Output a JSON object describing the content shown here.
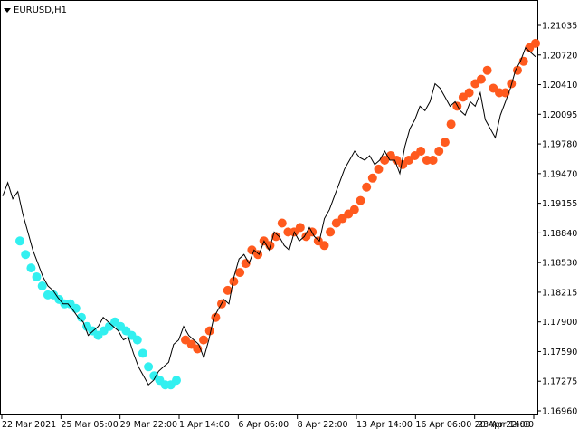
{
  "header": {
    "symbol_label": "EURUSD,H1",
    "dropdown_icon": "triangle-down-icon"
  },
  "colors": {
    "background": "#ffffff",
    "price_line": "#000000",
    "bullish_marker": "#ff5a1e",
    "bearish_marker": "#32f0f0",
    "axis": "#000000"
  },
  "chart_data": {
    "type": "line",
    "title": "",
    "xlabel": "",
    "ylabel": "",
    "x_tick_labels": [
      "22 Mar 2021",
      "25 Mar 05:00",
      "29 Mar 22:00",
      "1 Apr 14:00",
      "6 Apr 06:00",
      "8 Apr 22:00",
      "13 Apr 14:00",
      "16 Apr 06:00",
      "20 Apr 22:00",
      "23 Apr 14:00"
    ],
    "y_tick_labels": [
      "1.21035",
      "1.20720",
      "1.20410",
      "1.20095",
      "1.19780",
      "1.19470",
      "1.19155",
      "1.18840",
      "1.18530",
      "1.18215",
      "1.17900",
      "1.17590",
      "1.17275",
      "1.16960"
    ],
    "ylim": [
      1.1696,
      1.2125
    ],
    "grid": false,
    "series": [
      {
        "values": [
          1.1935,
          1.195,
          1.1932,
          1.194,
          1.1915,
          1.1895,
          1.1875,
          1.186,
          1.1845,
          1.1835,
          1.183,
          1.1822,
          1.1815,
          1.1815,
          1.1808,
          1.18,
          1.1795,
          1.178,
          1.1785,
          1.179,
          1.18,
          1.1795,
          1.179,
          1.1785,
          1.1775,
          1.1778,
          1.176,
          1.1745,
          1.1735,
          1.1725,
          1.173,
          1.174,
          1.1745,
          1.175,
          1.177,
          1.1775,
          1.179,
          1.178,
          1.1775,
          1.177,
          1.1755,
          1.1775,
          1.18,
          1.181,
          1.182,
          1.1815,
          1.1845,
          1.1865,
          1.187,
          1.186,
          1.1875,
          1.187,
          1.1885,
          1.1875,
          1.1895,
          1.189,
          1.188,
          1.1875,
          1.1895,
          1.1885,
          1.189,
          1.19,
          1.189,
          1.1885,
          1.191,
          1.192,
          1.1935,
          1.195,
          1.1965,
          1.1975,
          1.1985,
          1.1978,
          1.1975,
          1.198,
          1.197,
          1.1975,
          1.1985,
          1.1975,
          1.1975,
          1.196,
          1.199,
          1.201,
          1.202,
          1.2035,
          1.203,
          1.204,
          1.206,
          1.2055,
          1.2045,
          1.2035,
          1.204,
          1.203,
          1.2025,
          1.204,
          1.2035,
          1.205,
          1.202,
          1.201,
          1.2,
          1.2025,
          1.204,
          1.2055,
          1.2075,
          1.2085,
          1.21,
          1.2095,
          1.209
        ]
      }
    ],
    "markers": {
      "bullish_values": [
        1.1775,
        1.177,
        1.1765,
        1.1775,
        1.1785,
        1.18,
        1.1815,
        1.183,
        1.184,
        1.185,
        1.186,
        1.1875,
        1.187,
        1.1885,
        1.188,
        1.189,
        1.1905,
        1.1895,
        1.1895,
        1.19,
        1.189,
        1.1895,
        1.1885,
        1.188,
        1.1895,
        1.1905,
        1.191,
        1.1915,
        1.192,
        1.193,
        1.1945,
        1.1955,
        1.1965,
        1.1975,
        1.198,
        1.1975,
        1.197,
        1.1975,
        1.198,
        1.1985,
        1.1975,
        1.1975,
        1.1985,
        1.1995,
        1.2015,
        1.2035,
        1.2045,
        1.205,
        1.206,
        1.2065,
        1.2075,
        1.2055,
        1.205,
        1.205,
        1.206,
        1.2075,
        1.2085,
        1.21,
        1.2105
      ],
      "bearish_values": [
        1.1885,
        1.187,
        1.1855,
        1.1845,
        1.1835,
        1.1825,
        1.1825,
        1.182,
        1.1815,
        1.1815,
        1.181,
        1.18,
        1.179,
        1.1785,
        1.178,
        1.1785,
        1.179,
        1.1795,
        1.179,
        1.1785,
        1.178,
        1.1775,
        1.176,
        1.1745,
        1.1735,
        1.173,
        1.1725,
        1.1725,
        1.173
      ]
    }
  }
}
